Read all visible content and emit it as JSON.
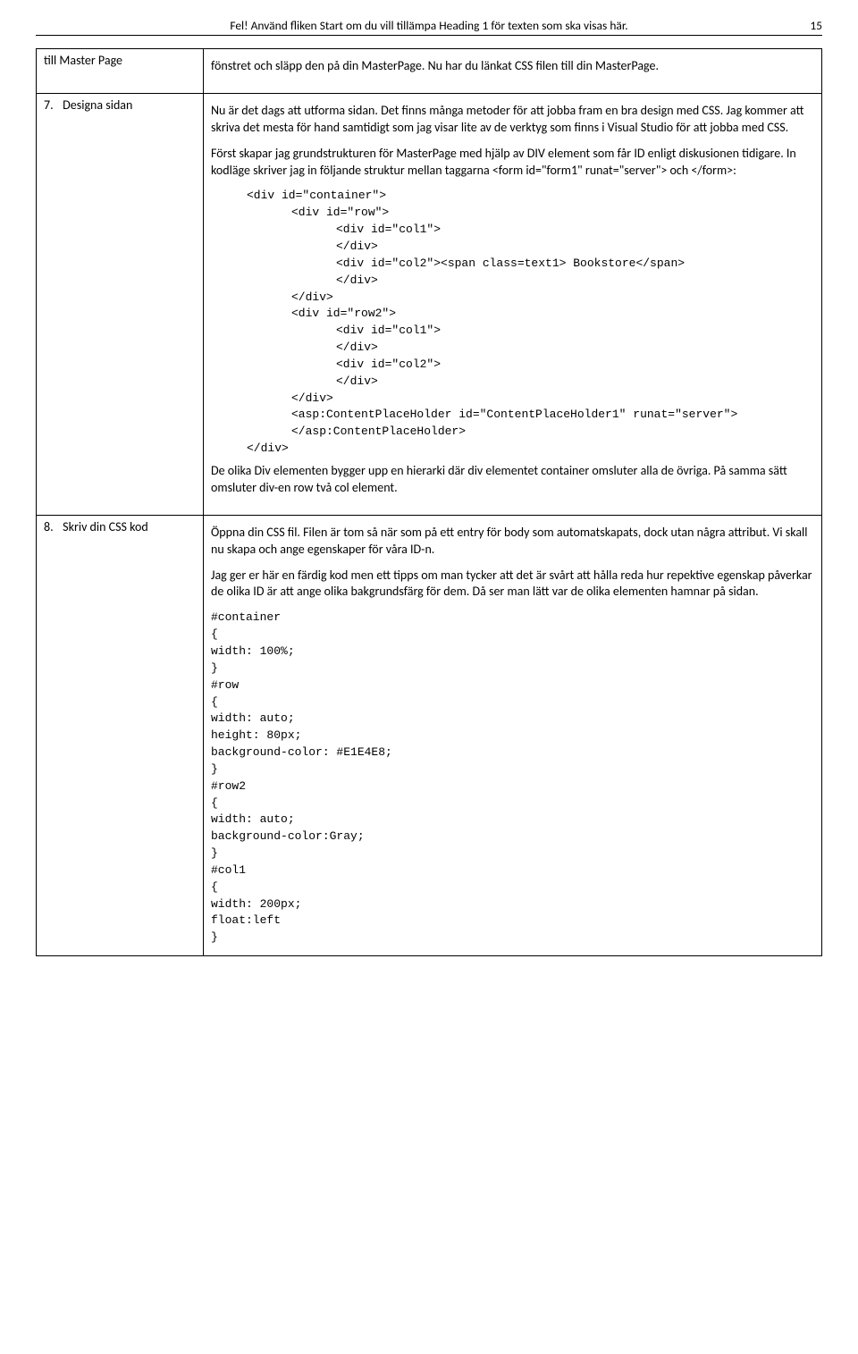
{
  "header": {
    "text": "Fel! Använd fliken Start om du vill tillämpa Heading 1 för texten som ska visas här.",
    "page_number": "15"
  },
  "rows": [
    {
      "left_num": "",
      "left_label": "till Master Page",
      "paragraphs": [
        "fönstret och släpp den på din MasterPage. Nu har du länkat CSS filen till din MasterPage."
      ]
    },
    {
      "left_num": "7.",
      "left_label": "Designa sidan",
      "paragraphs": [
        "Nu är det dags att utforma sidan. Det finns många metoder för att jobba fram en bra design med CSS. Jag kommer att skriva det mesta för hand samtidigt som jag visar lite av de verktyg som finns i Visual Studio för att jobba med CSS.",
        "Först skapar jag grundstrukturen för MasterPage med hjälp av DIV element som får ID enligt diskusionen tidigare. In kodläge skriver jag in följande struktur mellan taggarna <form id=\"form1\" runat=\"server\"> och </form>:"
      ],
      "code1": [
        {
          "indent": "i1",
          "text": "<div id=\"container\">"
        },
        {
          "indent": "i2",
          "text": "<div id=\"row\">"
        },
        {
          "indent": "i3",
          "text": "<div id=\"col1\">"
        },
        {
          "indent": "i3",
          "text": "</div>"
        },
        {
          "indent": "i3",
          "text": "<div id=\"col2\"><span class=text1> Bookstore</span>"
        },
        {
          "indent": "i3",
          "text": "</div>"
        },
        {
          "indent": "i2",
          "text": "</div>"
        },
        {
          "indent": "i2",
          "text": "<div id=\"row2\">"
        },
        {
          "indent": "i3",
          "text": "<div id=\"col1\">"
        },
        {
          "indent": "i3",
          "text": "</div>"
        },
        {
          "indent": "i3",
          "text": "<div id=\"col2\">"
        },
        {
          "indent": "i3",
          "text": "</div>"
        },
        {
          "indent": "i2",
          "text": "</div>"
        },
        {
          "indent": "i2",
          "text": "<asp:ContentPlaceHolder id=\"ContentPlaceHolder1\" runat=\"server\">"
        },
        {
          "indent": "i2",
          "text": ""
        },
        {
          "indent": "i2",
          "text": "</asp:ContentPlaceHolder>"
        },
        {
          "indent": "i1",
          "text": "</div>"
        }
      ],
      "paragraphs_after": [
        "De olika Div elementen bygger upp en hierarki där div elementet container omsluter alla de övriga. På samma sätt omsluter div-en row två col element."
      ]
    },
    {
      "left_num": "8.",
      "left_label": "Skriv din CSS kod",
      "paragraphs": [
        "Öppna din CSS fil. Filen är tom så när som på ett entry för body som automatskapats, dock utan några attribut. Vi skall nu skapa och ange egenskaper för våra ID-n.",
        "Jag ger er här en färdig kod men ett tipps om man tycker att det är svårt att hålla reda hur repektive egenskap påverkar de olika ID är att ange olika bakgrundsfärg för dem. Då ser man lätt var de olika elementen hamnar på sidan."
      ],
      "code1": [
        {
          "indent": "i0",
          "text": "#container"
        },
        {
          "indent": "i0",
          "text": "{"
        },
        {
          "indent": "i0",
          "text": "width: 100%;"
        },
        {
          "indent": "i0",
          "text": "}"
        },
        {
          "indent": "i0",
          "text": "#row"
        },
        {
          "indent": "i0",
          "text": "{"
        },
        {
          "indent": "i0",
          "text": "width: auto;"
        },
        {
          "indent": "i0",
          "text": "height: 80px;"
        },
        {
          "indent": "i0",
          "text": "background-color: #E1E4E8;"
        },
        {
          "indent": "i0",
          "text": "}"
        },
        {
          "indent": "i0",
          "text": "#row2"
        },
        {
          "indent": "i0",
          "text": "{"
        },
        {
          "indent": "i0",
          "text": "width: auto;"
        },
        {
          "indent": "i0",
          "text": "background-color:Gray;"
        },
        {
          "indent": "i0",
          "text": "}"
        },
        {
          "indent": "i0",
          "text": "#col1"
        },
        {
          "indent": "i0",
          "text": "{"
        },
        {
          "indent": "i0",
          "text": "width: 200px;"
        },
        {
          "indent": "i0",
          "text": "float:left"
        },
        {
          "indent": "i0",
          "text": "}"
        }
      ]
    }
  ]
}
